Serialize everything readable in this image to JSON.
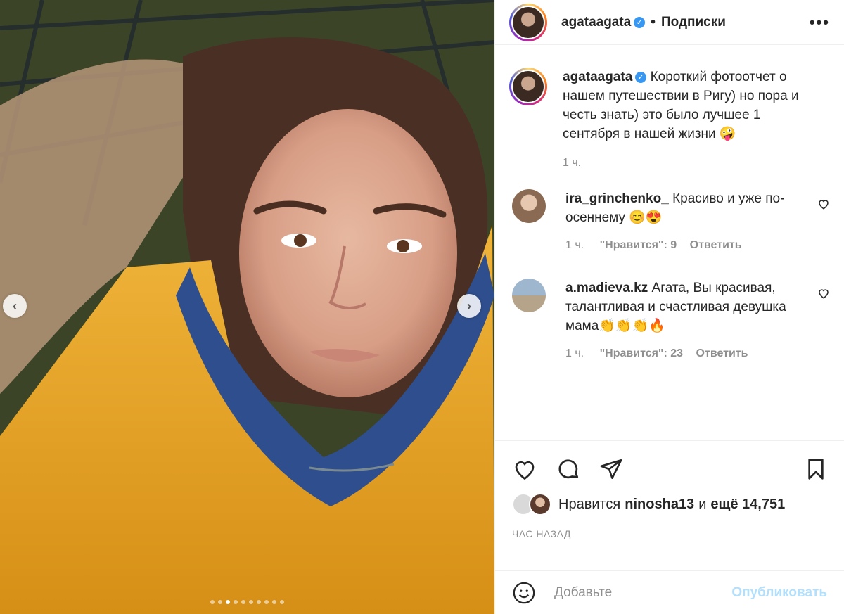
{
  "post": {
    "author": "agataagata",
    "follow_label": "Подписки",
    "more_label": "•••",
    "caption": "Короткий фотоотчет о нашем путешествии в Ригу) но пора и честь знать) это было лучшее 1 сентября в нашей жизни 🤪",
    "caption_time": "1 ч.",
    "likes_prefix": "Нравится",
    "likes_user": "ninosha13",
    "likes_and": "и",
    "likes_more": "ещё 14,751",
    "time_ago": "ЧАС НАЗАД",
    "slides_total": 10,
    "slide_active": 3
  },
  "comments": [
    {
      "user": "ira_grinchenko_",
      "text": "Красиво и уже по-осеннему 😊😍",
      "time": "1 ч.",
      "likes": "\"Нравится\": 9",
      "reply": "Ответить"
    },
    {
      "user": "a.madieva.kz",
      "text": "Агата, Вы красивая, талантливая и счастливая девушка мама👏👏👏🔥",
      "time": "1 ч.",
      "likes": "\"Нравится\": 23",
      "reply": "Ответить"
    }
  ],
  "add_comment": {
    "placeholder": "Добавьте",
    "publish_label": "Опубликовать"
  },
  "icons": {
    "prev": "chevron-left-icon",
    "next": "chevron-right-icon",
    "like": "heart-icon",
    "comment": "comment-icon",
    "share": "share-icon",
    "save": "bookmark-icon",
    "emoji": "emoji-icon",
    "verified": "verified-badge-icon"
  },
  "colors": {
    "verified": "#3897f0",
    "publish_disabled": "#b2dffc",
    "muted": "#8e8e8e"
  }
}
